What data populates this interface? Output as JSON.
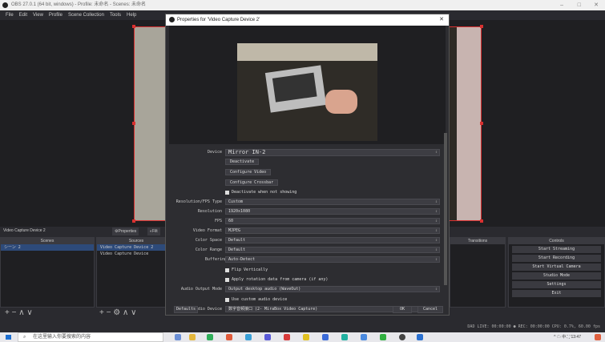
{
  "window": {
    "title": "OBS 27.0.1 (64 bit, windows) - Profile: 未命名 - Scenes: 未命名",
    "min": "–",
    "max": "□",
    "close": "✕"
  },
  "menu": [
    "File",
    "Edit",
    "View",
    "Profile",
    "Scene Collection",
    "Tools",
    "Help"
  ],
  "source_label": "Video Capture Device 2",
  "prop_buttons": {
    "properties": "Properties",
    "filters": "Filt"
  },
  "scenes": {
    "header": "Scenes",
    "items": [
      "シーン 2"
    ]
  },
  "sources": {
    "header": "Sources",
    "items": [
      "Video Capture Device 2",
      "Video Capture Device"
    ]
  },
  "transitions": {
    "header": "Transitions"
  },
  "controls": {
    "header": "Controls",
    "buttons": [
      "Start Streaming",
      "Start Recording",
      "Start Virtual Camera",
      "Studio Mode",
      "Settings",
      "Exit"
    ]
  },
  "toolbar": {
    "scenes": "+ − ∧ ∨",
    "sources": "+ − ⚙ ∧ ∨"
  },
  "status": {
    "text": "DAD LIVE: 00:00:00   ● REC: 00:00:00   CPU: 0.7%, 60.00 fps"
  },
  "dialog": {
    "title": "Properties for 'Video Capture Device 2'",
    "close": "✕",
    "device_label": "Device",
    "device_value": "Mirror IN-2",
    "deactivate": "Deactivate",
    "configure_video": "Configure Video",
    "configure_crossbar": "Configure Crossbar",
    "deactivate_check": "Deactivate when not showing",
    "res_fps_type_label": "Resolution/FPS Type",
    "res_fps_type": "Custom",
    "resolution_label": "Resolution",
    "resolution": "1920x1080",
    "fps_label": "FPS",
    "fps": "60",
    "video_format_label": "Video Format",
    "video_format": "MJPEG",
    "color_space_label": "Color Space",
    "color_space": "Default",
    "color_range_label": "Color Range",
    "color_range": "Default",
    "buffering_label": "Buffering",
    "buffering": "Auto-Detect",
    "flip": "Flip Vertically",
    "apply_rotation": "Apply rotation data from camera (if any)",
    "audio_output_label": "Audio Output Mode",
    "audio_output": "Output desktop audio (WaveOut)",
    "custom_audio": "Use custom audio device",
    "audio_device_label": "Audio Device",
    "audio_device": "数字音频接口 (2- MiraBox Video Capture)",
    "defaults": "Defaults",
    "ok": "OK",
    "cancel": "Cancel"
  },
  "taskbar": {
    "search": "在这里输入你要搜索的内容",
    "tray": "^ ☁ 中 ⛶",
    "clock": "13:47"
  }
}
